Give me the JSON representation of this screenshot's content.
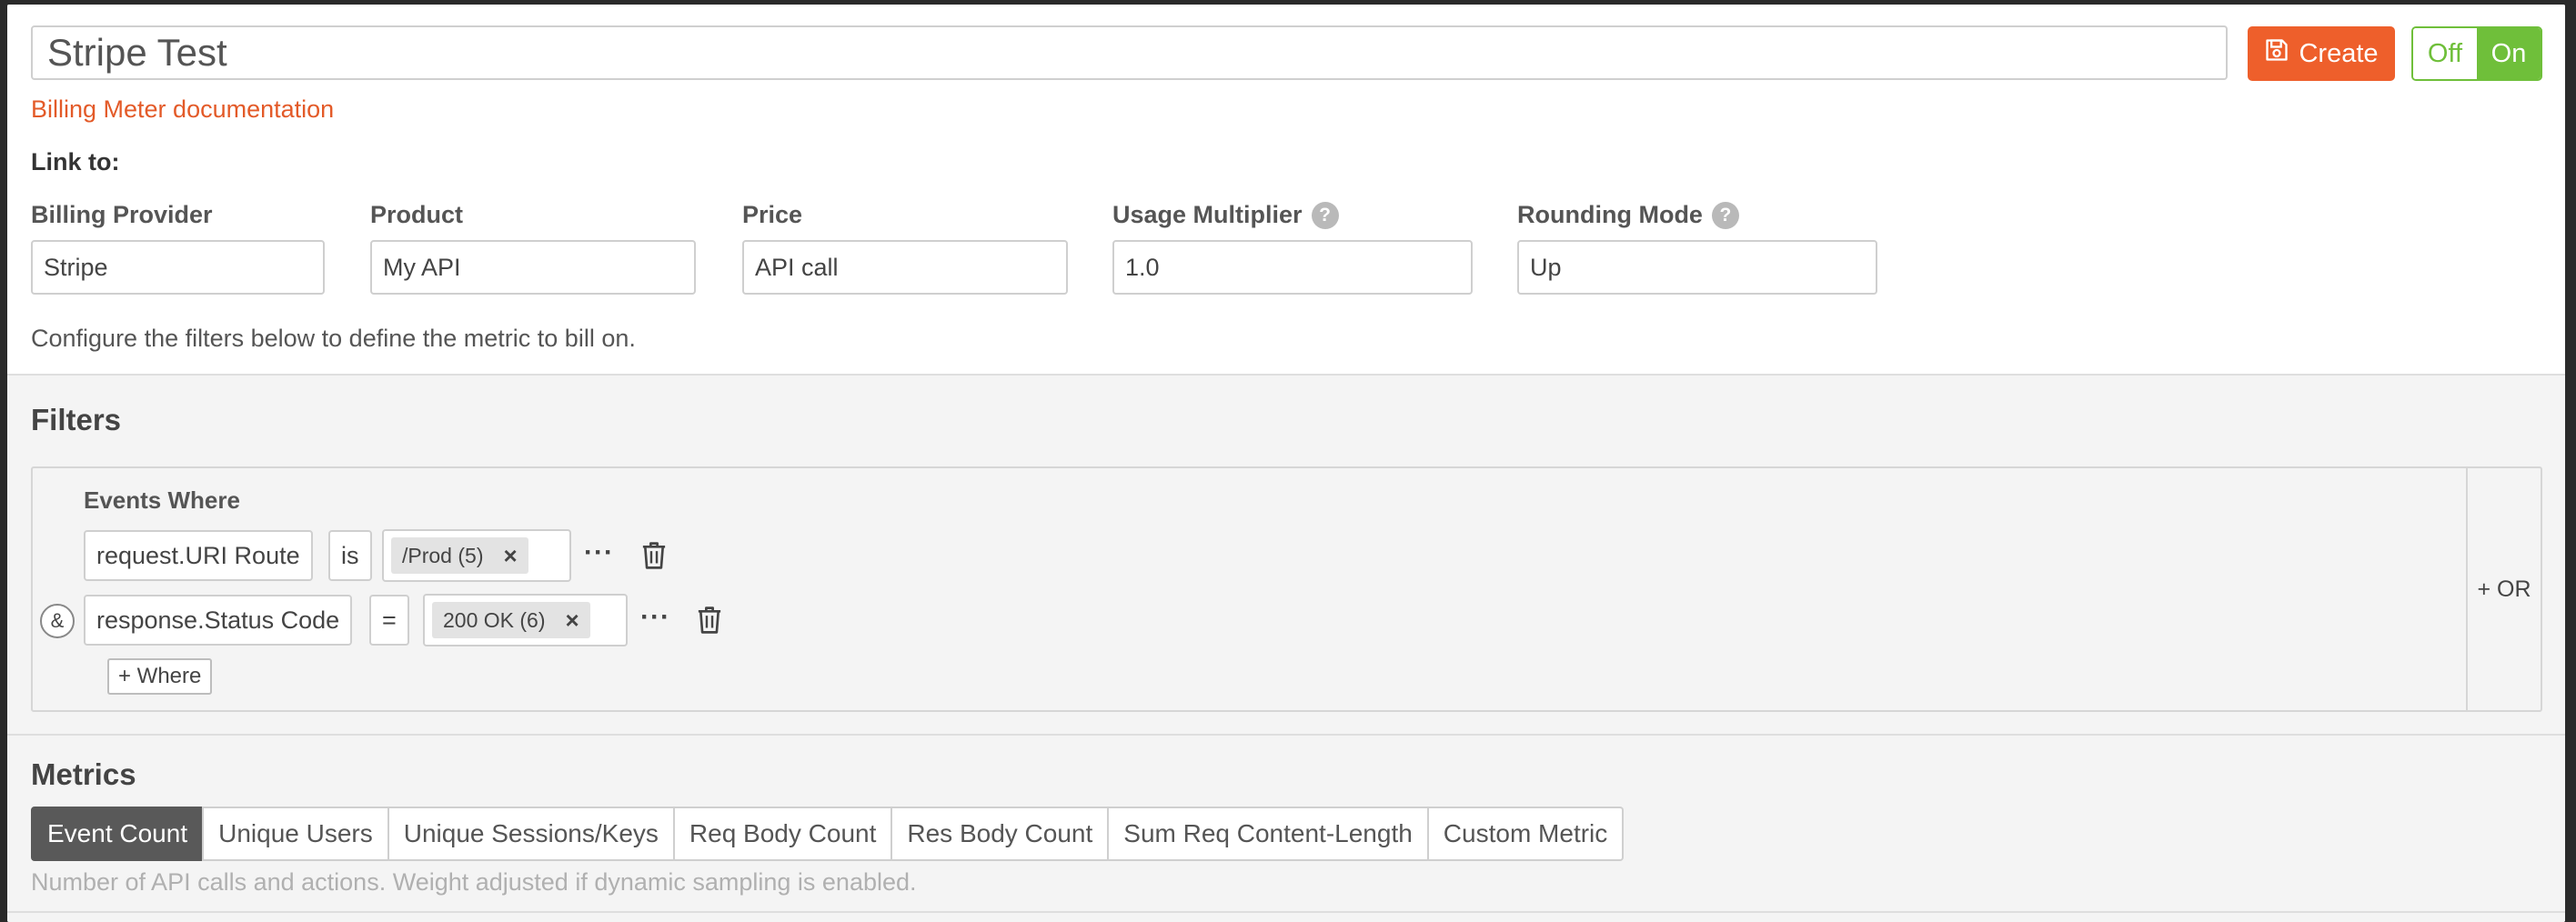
{
  "header": {
    "meter_name": "Stripe Test",
    "create_label": "Create",
    "toggle": {
      "off_label": "Off",
      "on_label": "On",
      "state": "On"
    },
    "accent_color": "#ee5f2b",
    "toggle_color": "#6fbf3a"
  },
  "doc_link": "Billing Meter documentation",
  "link_to_label": "Link to:",
  "fields": {
    "billing_provider": {
      "label": "Billing Provider",
      "value": "Stripe"
    },
    "product": {
      "label": "Product",
      "value": "My API"
    },
    "price": {
      "label": "Price",
      "value": "API call"
    },
    "usage_multiplier": {
      "label": "Usage Multiplier",
      "value": "1.0",
      "help": "?"
    },
    "rounding_mode": {
      "label": "Rounding Mode",
      "value": "Up",
      "help": "?"
    }
  },
  "helper_text": "Configure the filters below to define the metric to bill on.",
  "filters": {
    "title": "Filters",
    "events_where": "Events Where",
    "rows": [
      {
        "connector": "",
        "field": "request.URI Route",
        "operator": "is",
        "value": "/Prod (5)",
        "remove": "×",
        "more": "···"
      },
      {
        "connector": "&",
        "field": "response.Status Code",
        "operator": "=",
        "value": "200 OK (6)",
        "remove": "×",
        "more": "···"
      }
    ],
    "add_where": "+ Where",
    "add_or": "+ OR"
  },
  "metrics": {
    "title": "Metrics",
    "tabs": [
      "Event Count",
      "Unique Users",
      "Unique Sessions/Keys",
      "Req Body Count",
      "Res Body Count",
      "Sum Req Content-Length",
      "Custom Metric"
    ],
    "active_tab": "Event Count",
    "description": "Number of API calls and actions. Weight adjusted if dynamic sampling is enabled."
  }
}
